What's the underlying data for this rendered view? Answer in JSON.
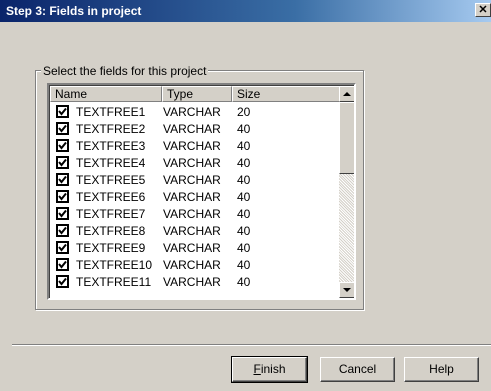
{
  "window": {
    "title": "Step 3: Fields in project",
    "close_glyph": "✕"
  },
  "group": {
    "label": "Select the fields for this project"
  },
  "list": {
    "columns": [
      "Name",
      "Type",
      "Size"
    ],
    "rows": [
      {
        "name": "TEXTFREE1",
        "type": "VARCHAR",
        "size": "20",
        "checked": true
      },
      {
        "name": "TEXTFREE2",
        "type": "VARCHAR",
        "size": "40",
        "checked": true
      },
      {
        "name": "TEXTFREE3",
        "type": "VARCHAR",
        "size": "40",
        "checked": true
      },
      {
        "name": "TEXTFREE4",
        "type": "VARCHAR",
        "size": "40",
        "checked": true
      },
      {
        "name": "TEXTFREE5",
        "type": "VARCHAR",
        "size": "40",
        "checked": true
      },
      {
        "name": "TEXTFREE6",
        "type": "VARCHAR",
        "size": "40",
        "checked": true
      },
      {
        "name": "TEXTFREE7",
        "type": "VARCHAR",
        "size": "40",
        "checked": true
      },
      {
        "name": "TEXTFREE8",
        "type": "VARCHAR",
        "size": "40",
        "checked": true
      },
      {
        "name": "TEXTFREE9",
        "type": "VARCHAR",
        "size": "40",
        "checked": true
      },
      {
        "name": "TEXTFREE10",
        "type": "VARCHAR",
        "size": "40",
        "checked": true
      },
      {
        "name": "TEXTFREE11",
        "type": "VARCHAR",
        "size": "40",
        "checked": true
      }
    ]
  },
  "buttons": {
    "finish": {
      "label_first": "F",
      "label_rest": "inish"
    },
    "cancel": "Cancel",
    "help": "Help"
  },
  "colors": {
    "title_bar": "#0a246a",
    "dialog_bg": "#d4d0c8"
  }
}
